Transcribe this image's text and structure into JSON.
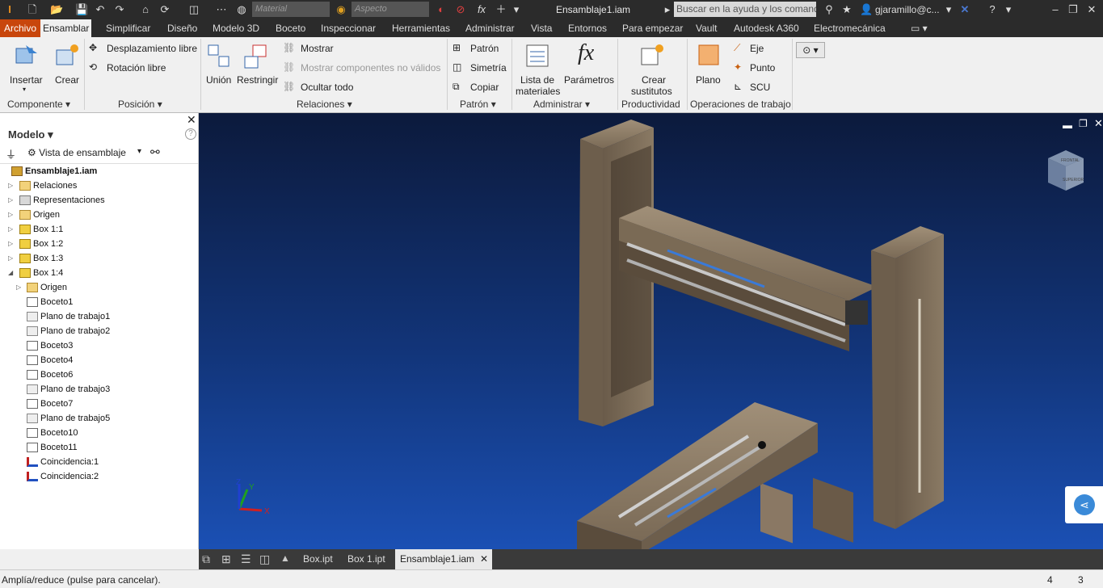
{
  "titlebar": {
    "material_placeholder": "Material",
    "appearance_placeholder": "Aspecto",
    "document_title": "Ensamblaje1.iam",
    "help_search_placeholder": "Buscar en la ayuda y los comandos...",
    "user": "gjaramillo@c...",
    "fx": "fx"
  },
  "ribbon_tabs": [
    "Archivo",
    "Ensamblar",
    "Simplificar",
    "Diseño",
    "Modelo 3D",
    "Boceto",
    "Inspeccionar",
    "Herramientas",
    "Administrar",
    "Vista",
    "Entornos",
    "Para empezar",
    "Vault",
    "Autodesk A360",
    "Electromecánica"
  ],
  "ribbon": {
    "componente": {
      "insertar": "Insertar",
      "crear": "Crear",
      "group": "Componente"
    },
    "posicion": {
      "desplazamiento": "Desplazamiento libre",
      "rotacion": "Rotación libre",
      "group": "Posición"
    },
    "relaciones": {
      "union": "Unión",
      "restringir": "Restringir",
      "mostrar": "Mostrar",
      "mostrar_no_validos": "Mostrar componentes no válidos",
      "ocultar_todo": "Ocultar todo",
      "group": "Relaciones"
    },
    "patron": {
      "patron": "Patrón",
      "simetria": "Simetría",
      "copiar": "Copiar",
      "group": "Patrón"
    },
    "administrar": {
      "lista1": "Lista de",
      "lista2": "materiales",
      "parametros": "Parámetros",
      "group": "Administrar"
    },
    "productividad": {
      "crear1": "Crear",
      "crear2": "sustitutos",
      "group": "Productividad"
    },
    "operaciones": {
      "plano": "Plano",
      "eje": "Eje",
      "punto": "Punto",
      "scu": "SCU",
      "group": "Operaciones de trabajo"
    }
  },
  "browser": {
    "title": "Modelo",
    "view": "Vista de ensamblaje",
    "root": "Ensamblaje1.iam",
    "items": [
      {
        "label": "Relaciones",
        "icon": "folder-icon"
      },
      {
        "label": "Representaciones",
        "icon": "representations-icon"
      },
      {
        "label": "Origen",
        "icon": "folder-icon"
      },
      {
        "label": "Box 1:1",
        "icon": "part-icon"
      },
      {
        "label": "Box 1:2",
        "icon": "part-icon"
      },
      {
        "label": "Box 1:3",
        "icon": "part-icon"
      },
      {
        "label": "Box 1:4",
        "icon": "part-icon"
      }
    ],
    "children": [
      {
        "label": "Origen",
        "icon": "folder-icon"
      },
      {
        "label": "Boceto1",
        "icon": "sketch-icon"
      },
      {
        "label": "Plano de trabajo1",
        "icon": "workplane-icon"
      },
      {
        "label": "Plano de trabajo2",
        "icon": "workplane-icon"
      },
      {
        "label": "Boceto3",
        "icon": "sketch-icon"
      },
      {
        "label": "Boceto4",
        "icon": "sketch-icon"
      },
      {
        "label": "Boceto6",
        "icon": "sketch-icon"
      },
      {
        "label": "Plano de trabajo3",
        "icon": "workplane-icon"
      },
      {
        "label": "Boceto7",
        "icon": "sketch-icon"
      },
      {
        "label": "Plano de trabajo5",
        "icon": "workplane-icon"
      },
      {
        "label": "Boceto10",
        "icon": "sketch-icon"
      },
      {
        "label": "Boceto11",
        "icon": "sketch-icon"
      },
      {
        "label": "Coincidencia:1",
        "icon": "constraint-icon"
      },
      {
        "label": "Coincidencia:2",
        "icon": "constraint-icon"
      }
    ]
  },
  "viewport": {
    "cube_labels": [
      "FRONTAL",
      "SUPERIOR"
    ],
    "axes": [
      "X",
      "Y",
      "Z"
    ]
  },
  "doc_tabs": [
    "Box.ipt",
    "Box 1.ipt",
    "Ensamblaje1.iam"
  ],
  "status": {
    "message": "Amplía/reduce (pulse para cancelar).",
    "count1": "4",
    "count2": "3"
  },
  "colors": {
    "accent": "#c8460c",
    "viewport_top": "#0c1a3c",
    "viewport_bottom": "#1b50b4"
  }
}
